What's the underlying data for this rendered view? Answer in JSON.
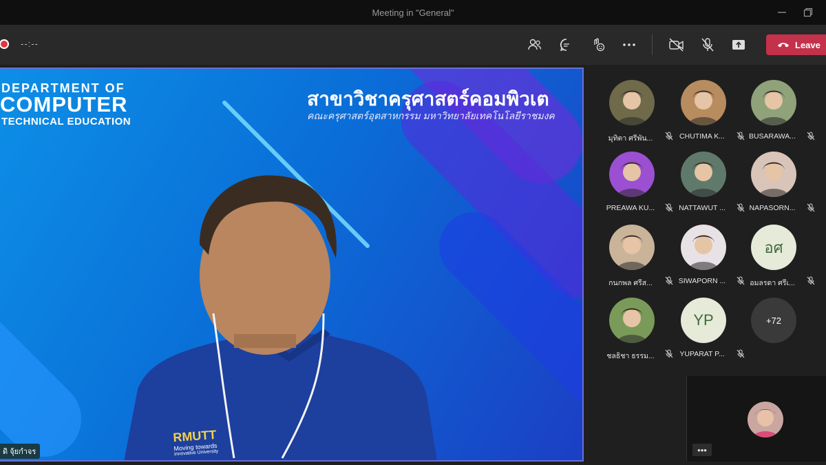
{
  "window": {
    "title": "Meeting in \"General\""
  },
  "toolbar": {
    "timer": "--:--",
    "leave_label": "Leave",
    "icons": [
      "participants-icon",
      "chat-icon",
      "reactions-icon",
      "more-options-icon",
      "camera-off-icon",
      "mic-off-icon",
      "share-screen-icon",
      "phone-hangup-icon"
    ]
  },
  "main_video": {
    "banner_line1": "DEPARTMENT OF",
    "banner_line2": "COMPUTER",
    "banner_line3": "TECHNICAL EDUCATION",
    "thai_title": "สาขาวิชาครุศาสตร์คอมพิวเต",
    "thai_subtitle": "คณะครุศาสตร์อุตสาหกรรม มหาวิทยาลัยเทคโนโลยีราชมงค",
    "speaker_name": "ดิ จุ้ยกำจร",
    "shirt_text_1": "RMUTT",
    "shirt_text_2": "Moving towards",
    "shirt_text_3": "innovative University"
  },
  "participants": [
    {
      "name": "มุทิตา ศรีพัน...",
      "type": "photo",
      "color": "#6e6a4a"
    },
    {
      "name": "CHUTIMA K...",
      "type": "photo",
      "color": "#b78c5e"
    },
    {
      "name": "BUSARAWA...",
      "type": "photo",
      "color": "#8fa27a"
    },
    {
      "name": "PREAWA KU...",
      "type": "photo",
      "color": "#9b4fd1"
    },
    {
      "name": "NATTAWUT ...",
      "type": "photo",
      "color": "#5f7a6a"
    },
    {
      "name": "NAPASORN...",
      "type": "photo",
      "color": "#d8c4b8"
    },
    {
      "name": "กนกพล ศรีส...",
      "type": "photo",
      "color": "#c9b49a"
    },
    {
      "name": "SIWAPORN ...",
      "type": "photo",
      "color": "#e8e2e6"
    },
    {
      "name": "อมลรดา ศรีเ...",
      "type": "initials",
      "initials": "อศ"
    },
    {
      "name": "ชลธิชา ธรรม...",
      "type": "photo",
      "color": "#7a9a5a"
    },
    {
      "name": "YUPARAT P...",
      "type": "initials",
      "initials": "YP"
    },
    {
      "name": "",
      "type": "more",
      "initials": "+72"
    }
  ],
  "self_view": {
    "more_label": "•••"
  }
}
